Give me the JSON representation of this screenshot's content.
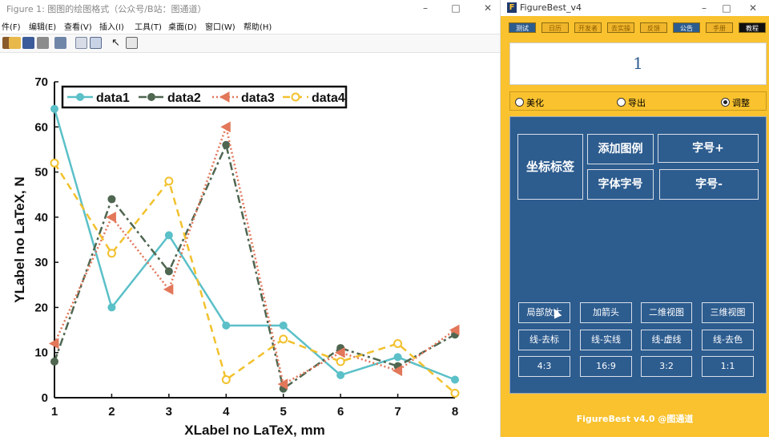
{
  "figure_window": {
    "title": "Figure 1: 图图的绘图格式（公众号/B站：图通道）",
    "menu": [
      "件(F)",
      "编辑(E)",
      "查看(V)",
      "插入(I)",
      "工具(T)",
      "桌面(D)",
      "窗口(W)",
      "帮助(H)"
    ]
  },
  "chart_data": {
    "type": "line",
    "x": [
      1,
      2,
      3,
      4,
      5,
      6,
      7,
      8
    ],
    "series": [
      {
        "name": "data1",
        "values": [
          64,
          20,
          36,
          16,
          16,
          5,
          9,
          4
        ],
        "color": "#5bc0c8",
        "dash": "solid",
        "marker": "circle"
      },
      {
        "name": "data2",
        "values": [
          8,
          44,
          28,
          56,
          2,
          11,
          7,
          14
        ],
        "color": "#4f6650",
        "dash": "dashdot",
        "marker": "circle"
      },
      {
        "name": "data3",
        "values": [
          12,
          40,
          24,
          60,
          3,
          10,
          6,
          15
        ],
        "color": "#e2775a",
        "dash": "dotted",
        "marker": "triangle-left"
      },
      {
        "name": "data4",
        "values": [
          52,
          32,
          48,
          4,
          13,
          8,
          12,
          1
        ],
        "color": "#f2c12e",
        "dash": "dashed",
        "marker": "circle-open"
      }
    ],
    "xlabel": "XLabel no LaTeX, mm",
    "ylabel": "YLabel no LaTeX, N",
    "xlim": [
      1,
      8
    ],
    "ylim": [
      0,
      70
    ],
    "xticks": [
      1,
      2,
      3,
      4,
      5,
      6,
      7,
      8
    ],
    "yticks": [
      0,
      10,
      20,
      30,
      40,
      50,
      60,
      70
    ],
    "grid": false,
    "legend": "top, horizontal"
  },
  "figurebest": {
    "title": "FigureBest_v4",
    "top_buttons": [
      {
        "label": "测试",
        "style": "blue"
      },
      {
        "label": "日历",
        "style": "gold"
      },
      {
        "label": "开发者",
        "style": "gold"
      },
      {
        "label": "去实操",
        "style": "gold"
      },
      {
        "label": "反馈",
        "style": "gold"
      },
      {
        "label": "公告",
        "style": "blue"
      },
      {
        "label": "手册",
        "style": "gold"
      },
      {
        "label": "教程",
        "style": "dark"
      }
    ],
    "counter_value": "1",
    "modes": [
      {
        "label": "美化",
        "selected": false
      },
      {
        "label": "导出",
        "selected": false
      },
      {
        "label": "调整",
        "selected": true
      }
    ],
    "big_buttons": {
      "axis_label": "坐标标签",
      "add_legend": "添加图例",
      "font_size_up": "字号+",
      "font_family": "字体字号",
      "font_size_down": "字号-"
    },
    "small_buttons": [
      "局部放大",
      "加箭头",
      "二维视图",
      "三维视图",
      "线-去标",
      "线-实线",
      "线-虚线",
      "线-去色",
      "4:3",
      "16:9",
      "3:2",
      "1:1"
    ],
    "footer": "FigureBest v4.0 @图通道"
  }
}
